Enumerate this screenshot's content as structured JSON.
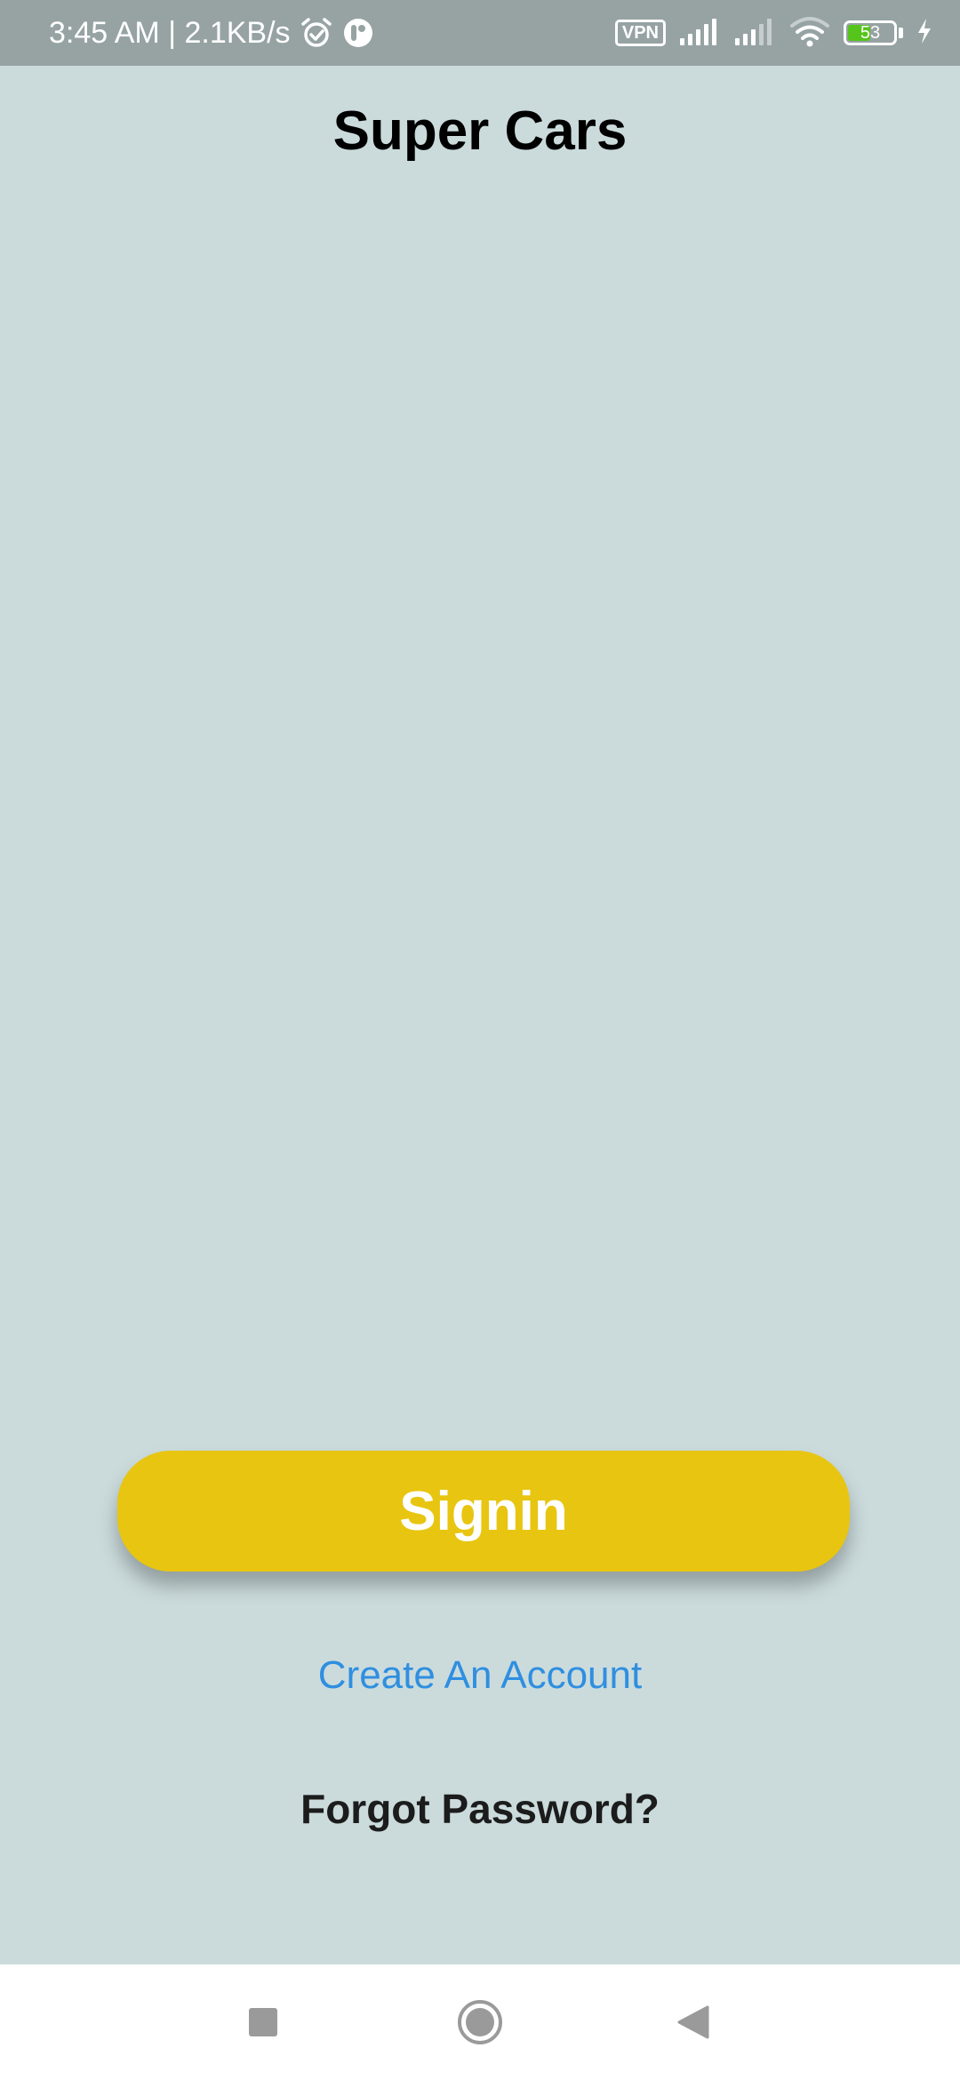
{
  "status_bar": {
    "time_and_speed": "3:45 AM | 2.1KB/s",
    "vpn_label": "VPN",
    "battery_level": "53",
    "battery_fraction": 0.53,
    "icons": [
      "alarm-icon",
      "app-notification-icon",
      "vpn-icon",
      "signal-1-icon",
      "signal-2-icon",
      "wifi-icon",
      "battery-icon",
      "charging-icon"
    ]
  },
  "header": {
    "title": "Super Cars"
  },
  "actions": {
    "signin_label": "Signin",
    "create_account_label": "Create An Account",
    "forgot_password_label": "Forgot Password?"
  },
  "nav_bar": {
    "icons": [
      "recents-square-icon",
      "home-circle-icon",
      "back-triangle-icon"
    ]
  },
  "colors": {
    "background": "#cbdbdc",
    "status_bar": "#97a3a3",
    "signin_button": "#e8c511",
    "create_account_link": "#2f8fe0",
    "battery_fill": "#55c41b"
  }
}
